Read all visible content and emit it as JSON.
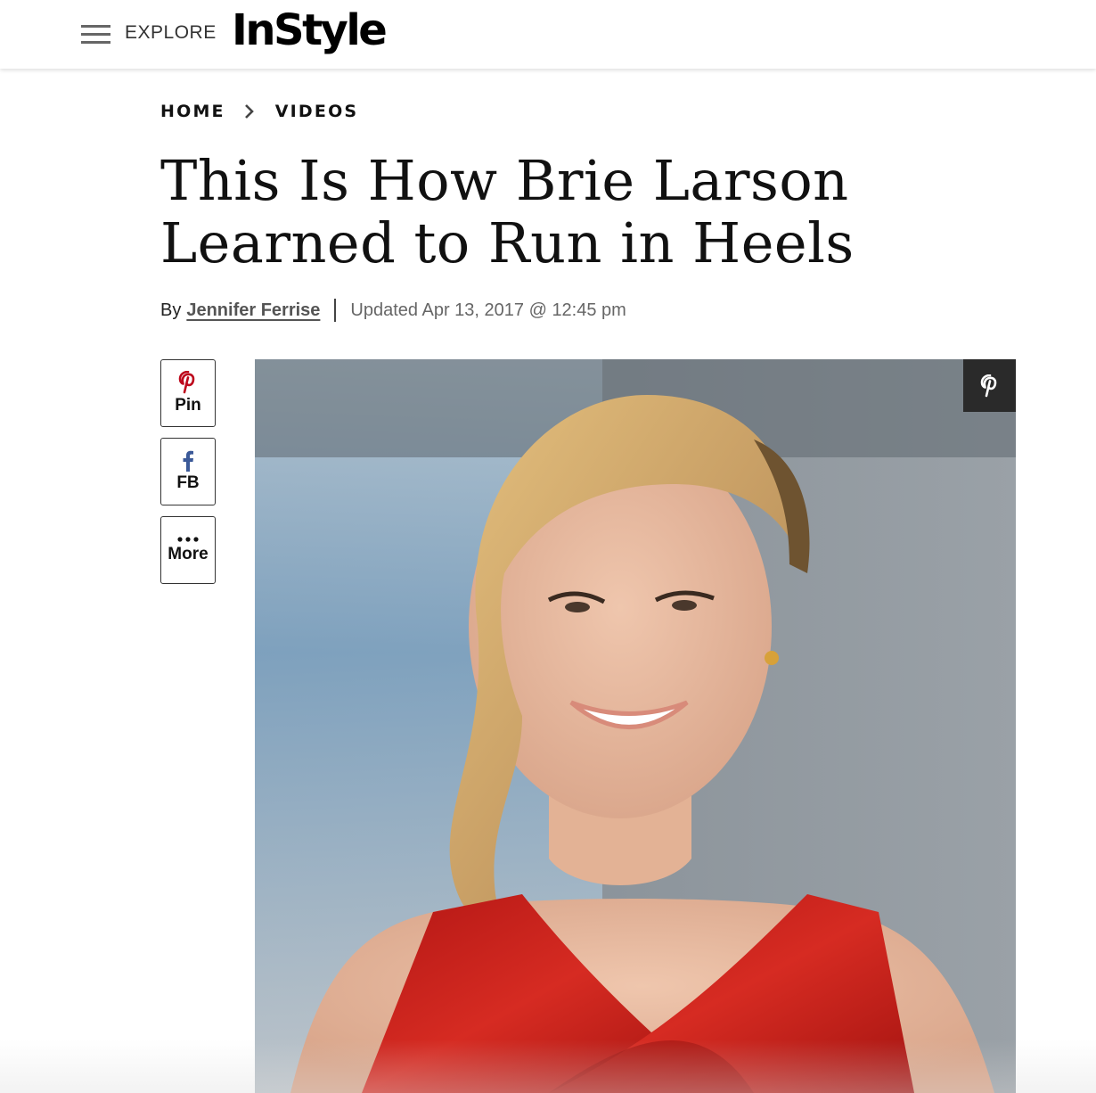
{
  "header": {
    "explore_label": "EXPLORE",
    "logo_text": "InStyle"
  },
  "breadcrumb": {
    "items": [
      "HOME",
      "VIDEOS"
    ]
  },
  "article": {
    "title": "This Is How Brie Larson Learned to Run in Heels",
    "by_label": "By",
    "author": "Jennifer Ferrise",
    "updated": "Updated Apr 13, 2017 @ 12:45 pm"
  },
  "share": {
    "pin_label": "Pin",
    "fb_label": "FB",
    "more_label": "More"
  },
  "hero_image": {
    "subject": "woman with side-swept blonde hair in a red criss-cross dress, smiling",
    "pin_overlay_icon": "pinterest-icon"
  },
  "colors": {
    "pinterest_red": "#bd081c",
    "facebook_blue": "#3b5998",
    "dress_red": "#c8211e",
    "overlay_dark": "#2a2a2a"
  }
}
